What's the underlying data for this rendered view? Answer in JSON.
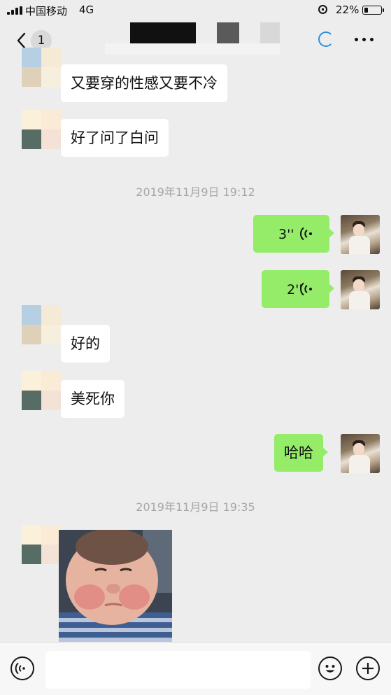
{
  "status_bar": {
    "carrier": "中国移动",
    "network": "4G",
    "battery_percent": "22%",
    "battery_level": 0.22
  },
  "nav": {
    "unread_count": "1"
  },
  "messages": [
    {
      "side": "in",
      "type": "text",
      "text": "又要穿的性感又要不冷"
    },
    {
      "side": "in",
      "type": "text",
      "text": "好了问了白问"
    },
    {
      "type": "timestamp",
      "text": "2019年11月9日 19:12"
    },
    {
      "side": "out",
      "type": "voice",
      "duration": "3''"
    },
    {
      "side": "out",
      "type": "voice",
      "duration": "2''"
    },
    {
      "side": "in",
      "type": "text",
      "text": "好的"
    },
    {
      "side": "in",
      "type": "text",
      "text": "美死你"
    },
    {
      "side": "out",
      "type": "text",
      "text": "哈哈"
    },
    {
      "type": "timestamp",
      "text": "2019年11月9日 19:35"
    },
    {
      "side": "in",
      "type": "sticker"
    }
  ],
  "input_bar": {
    "placeholder": "",
    "icons": [
      "voice-input-icon",
      "emoji-icon",
      "add-icon"
    ]
  },
  "colors": {
    "background": "#ededed",
    "outgoing_bubble": "#95ec69",
    "incoming_bubble": "#ffffff",
    "accent": "#2d8ee0"
  }
}
